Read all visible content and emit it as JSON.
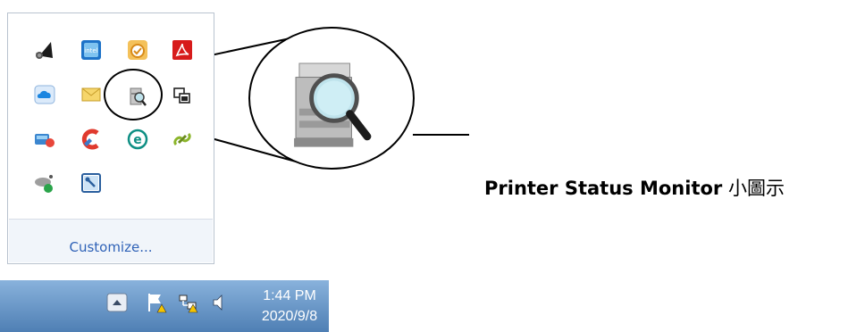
{
  "tray": {
    "customize_label": "Customize...",
    "icons": [
      "speaker-icon",
      "intel-graphics-icon",
      "clock-app-icon",
      "acrobat-icon",
      "cloud-icon",
      "mail-icon",
      "printer-status-monitor-icon",
      "window-switch-icon",
      "network-adapter-icon",
      "ccleaner-icon",
      "e-app-icon",
      "link-icon",
      "satellite-icon",
      "remote-tool-icon"
    ]
  },
  "callout": {
    "bold_label": "Printer Status Monitor",
    "suffix": " 小圖示"
  },
  "taskbar": {
    "time": "1:44 PM",
    "date": "2020/9/8",
    "icons": [
      "show-hidden-icons-button",
      "action-center-flag-icon",
      "network-warning-icon",
      "volume-icon"
    ]
  },
  "colors": {
    "link": "#2f62b7",
    "taskbar": "#5a88bd",
    "border": "#b9c3cf"
  }
}
